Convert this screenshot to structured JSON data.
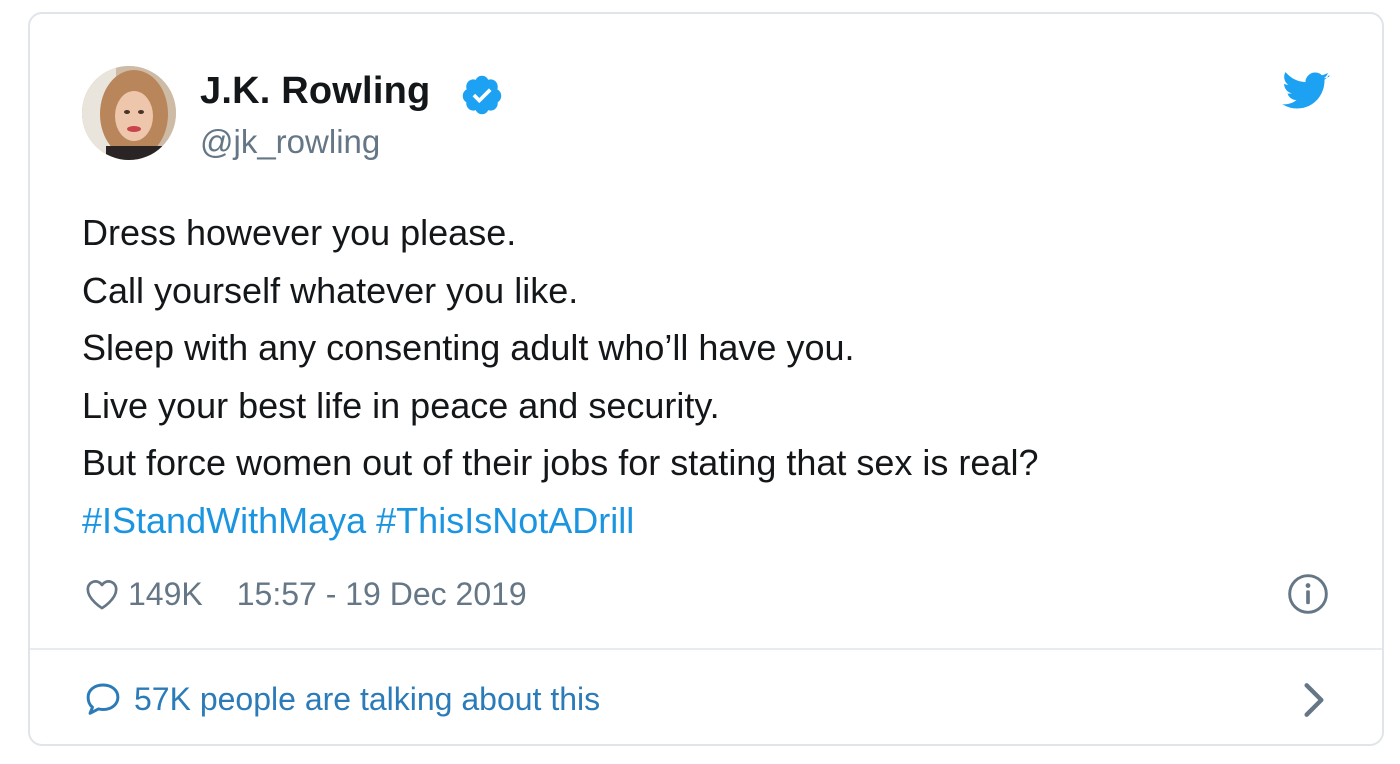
{
  "author": {
    "display_name": "J.K. Rowling",
    "handle": "@jk_rowling",
    "verified": true,
    "avatar_icon": "avatar"
  },
  "tweet": {
    "lines": [
      "Dress however you please.",
      "Call yourself whatever you like.",
      "Sleep with any consenting adult who’ll have you.",
      "Live your best life in peace and security.",
      "But force women out of their jobs for stating that sex is real?"
    ],
    "hashtags": [
      "#IStandWithMaya",
      "#ThisIsNotADrill"
    ]
  },
  "meta": {
    "likes": "149K",
    "timestamp": "15:57 - 19 Dec 2019"
  },
  "footer": {
    "talking_text": "57K people are talking about this"
  },
  "icons": {
    "logo": "twitter-bird-icon",
    "verified": "verified-badge-icon",
    "like": "heart-icon",
    "info": "info-icon",
    "comment": "comment-icon",
    "chevron": "chevron-right-icon"
  },
  "colors": {
    "brand_blue": "#1da1f2",
    "link_blue": "#1b95e0",
    "footer_blue": "#2b7bb9",
    "text": "#14171a",
    "muted": "#657786",
    "border": "#dfe5ea"
  }
}
